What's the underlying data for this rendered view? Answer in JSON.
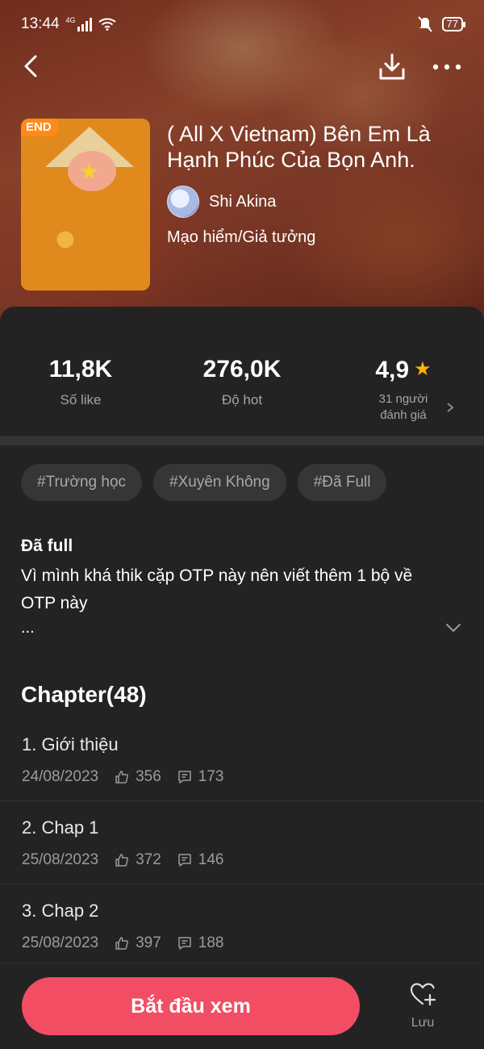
{
  "status_bar": {
    "time": "13:44",
    "network": "4G",
    "battery": "77"
  },
  "story": {
    "badge": "END",
    "title": "( All X Vietnam) Bên Em Là Hạnh Phúc Của Bọn Anh.",
    "author": "Shi Akina",
    "genre": "Mạo hiểm/Giả tưởng"
  },
  "stats": {
    "likes_value": "11,8K",
    "likes_label": "Số like",
    "hot_value": "276,0K",
    "hot_label": "Độ hot",
    "rating_value": "4,9",
    "rating_label_line1": "31 người",
    "rating_label_line2": "đánh giá"
  },
  "tags": [
    "#Trường học",
    "#Xuyên Không",
    "#Đã Full"
  ],
  "description": {
    "heading": "Đã full",
    "text": "Vì mình khá thik cặp OTP này nên viết thêm 1 bộ về OTP này",
    "ellipsis": "..."
  },
  "chapters": {
    "heading": "Chapter(48)",
    "items": [
      {
        "title": "1. Giới thiệu",
        "date": "24/08/2023",
        "likes": "356",
        "comments": "173"
      },
      {
        "title": "2. Chap 1",
        "date": "25/08/2023",
        "likes": "372",
        "comments": "146"
      },
      {
        "title": "3. Chap 2",
        "date": "25/08/2023",
        "likes": "397",
        "comments": "188"
      }
    ]
  },
  "bottom": {
    "start_label": "Bắt đầu xem",
    "save_label": "Lưu"
  },
  "colors": {
    "accent": "#f34d64",
    "badge": "#ff8a1a",
    "star": "#ffb400",
    "background": "#232323"
  },
  "icons": [
    "back-arrow-icon",
    "download-icon",
    "more-icon",
    "star-icon",
    "chevron-right-icon",
    "chevron-down-icon",
    "thumbs-up-icon",
    "comment-icon",
    "heart-plus-icon"
  ]
}
